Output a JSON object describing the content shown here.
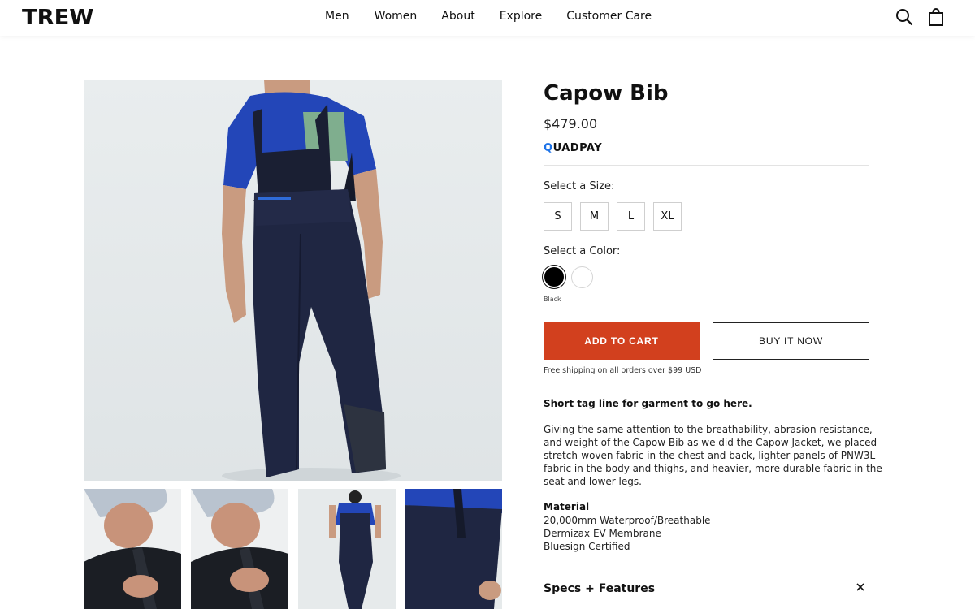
{
  "header": {
    "logo": "TREW",
    "nav": [
      "Men",
      "Women",
      "About",
      "Explore",
      "Customer Care"
    ],
    "icons": [
      "search-icon",
      "shopping-bag-icon"
    ]
  },
  "product": {
    "title": "Capow Bib",
    "price": "$479.00",
    "quadpay_prefix": "Q",
    "quadpay_rest": "UADPAY",
    "size_label": "Select a Size:",
    "sizes": [
      "S",
      "M",
      "L",
      "XL"
    ],
    "color_label": "Select a Color:",
    "colors": [
      {
        "name": "Black",
        "hex": "#000000",
        "selected": true
      },
      {
        "name": "White",
        "hex": "#ffffff",
        "selected": false
      }
    ],
    "selected_color_name": "Black",
    "add_to_cart": "ADD TO CART",
    "buy_it_now": "BUY IT NOW",
    "shipping_note": "Free shipping on all orders over $99 USD",
    "tagline": "Short tag line for garment to go here.",
    "description": "Giving the same attention to the breathability, abrasion resistance, and weight of the Capow Bib as we did the Capow Jacket, we placed stretch-woven fabric in the chest and back, lighter panels of PNW3L fabric in the body and thighs, and heavier, more durable fabric in the seat and lower legs.",
    "material_heading": "Material",
    "materials": [
      "20,000mm Waterproof/Breathable",
      "Dermizax EV Membrane",
      "Bluesign Certified"
    ],
    "specs_heading": "Specs + Features"
  },
  "colors": {
    "accent": "#d2401e",
    "quadpay_blue": "#1d73e8"
  }
}
